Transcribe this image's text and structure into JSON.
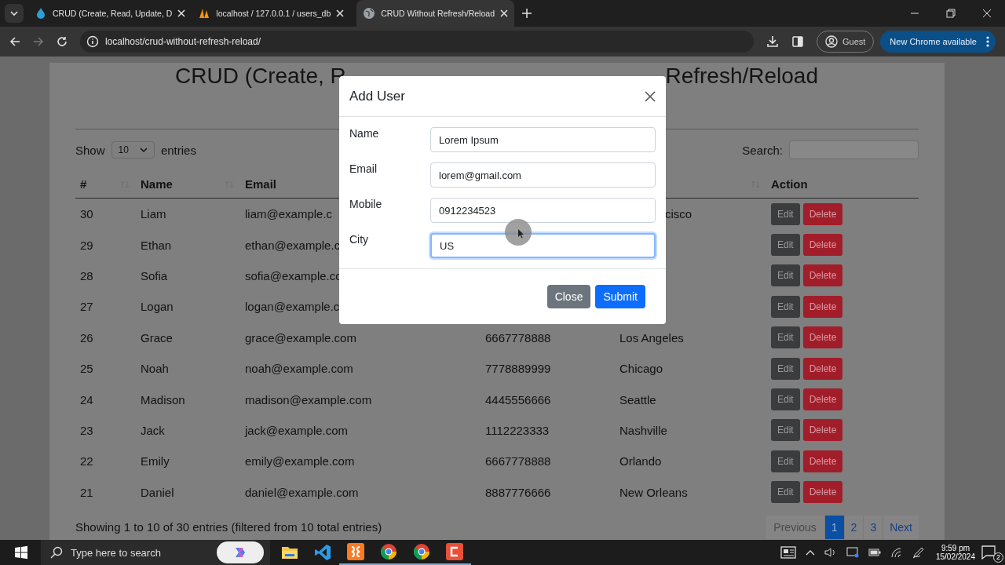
{
  "browser": {
    "tabs": [
      {
        "title": "CRUD (Create, Read, Update, D",
        "kind": "drop",
        "selected": false
      },
      {
        "title": "localhost / 127.0.0.1 / users_db",
        "kind": "sail",
        "selected": false
      },
      {
        "title": "CRUD Without Refresh/Reload",
        "kind": "globe",
        "selected": true
      }
    ],
    "url": "localhost/crud-without-refresh-reload/",
    "profile": "Guest",
    "update": "New Chrome available"
  },
  "page": {
    "title_parts": [
      "CRUD (Create, R",
      "Refresh/Reload"
    ],
    "show_label": "Show",
    "page_length": "10",
    "entries_label": "entries",
    "search_label": "Search:",
    "columns": [
      {
        "label": "#",
        "sort_icon": true
      },
      {
        "label": "Name",
        "sort_icon": true
      },
      {
        "label": "Email",
        "sort_icon": false
      },
      {},
      {
        "sort_icon": true
      },
      {
        "label": "Action",
        "sort_icon": false
      }
    ],
    "rows": [
      {
        "id": "30",
        "name": "Liam",
        "email": "liam@example.c",
        "city": "cisco",
        "city_cut": true,
        "actions": [
          "Edit",
          "Delete"
        ]
      },
      {
        "id": "29",
        "name": "Ethan",
        "email": "ethan@example.c",
        "actions": [
          "Edit",
          "Delete"
        ]
      },
      {
        "id": "28",
        "name": "Sofia",
        "email": "sofia@example.co",
        "actions": [
          "Edit",
          "Delete"
        ]
      },
      {
        "id": "27",
        "name": "Logan",
        "email": "logan@example.c",
        "actions": [
          "Edit",
          "Delete"
        ]
      },
      {
        "id": "26",
        "name": "Grace",
        "email": "grace@example.com",
        "mobile": "6667778888",
        "city": "Los Angeles",
        "actions": [
          "Edit",
          "Delete"
        ]
      },
      {
        "id": "25",
        "name": "Noah",
        "email": "noah@example.com",
        "mobile": "7778889999",
        "city": "Chicago",
        "actions": [
          "Edit",
          "Delete"
        ]
      },
      {
        "id": "24",
        "name": "Madison",
        "email": "madison@example.com",
        "mobile": "4445556666",
        "city": "Seattle",
        "actions": [
          "Edit",
          "Delete"
        ]
      },
      {
        "id": "23",
        "name": "Jack",
        "email": "jack@example.com",
        "mobile": "1112223333",
        "city": "Nashville",
        "actions": [
          "Edit",
          "Delete"
        ]
      },
      {
        "id": "22",
        "name": "Emily",
        "email": "emily@example.com",
        "mobile": "6667778888",
        "city": "Orlando",
        "actions": [
          "Edit",
          "Delete"
        ]
      },
      {
        "id": "21",
        "name": "Daniel",
        "email": "daniel@example.com",
        "mobile": "8887776666",
        "city": "New Orleans",
        "actions": [
          "Edit",
          "Delete"
        ]
      }
    ],
    "info": "Showing 1 to 10 of 30 entries (filtered from 10 total entries)",
    "pagination": [
      {
        "label": "Previous",
        "kind": "nav",
        "selected": false
      },
      {
        "label": "1",
        "kind": "page",
        "selected": true
      },
      {
        "label": "2",
        "kind": "page",
        "selected": false
      },
      {
        "label": "3",
        "kind": "page",
        "selected": false
      },
      {
        "label": "Next",
        "kind": "nav",
        "selected": false
      }
    ]
  },
  "modal": {
    "title": "Add User",
    "fields": [
      {
        "label": "Name",
        "value": "Lorem Ipsum",
        "focused": false
      },
      {
        "label": "Email",
        "value": "lorem@gmail.com",
        "focused": false
      },
      {
        "label": "Mobile",
        "value": "0912234523",
        "focused": false
      },
      {
        "label": "City",
        "value": "US",
        "focused": true
      }
    ],
    "buttons": [
      {
        "label": "Close",
        "kind": "secondary"
      },
      {
        "label": "Submit",
        "kind": "primary"
      }
    ]
  },
  "taskbar": {
    "search_placeholder": "Type here to search",
    "apps": [
      {
        "kind": "folder",
        "running": false
      },
      {
        "kind": "code",
        "running": false
      },
      {
        "kind": "xampp",
        "running": true
      },
      {
        "kind": "chrome-alt",
        "running": true
      },
      {
        "kind": "chrome",
        "running": true
      },
      {
        "kind": "recorder",
        "running": true
      }
    ],
    "time": "9:59 pm",
    "date": "15/02/2024",
    "notifications": "2"
  }
}
